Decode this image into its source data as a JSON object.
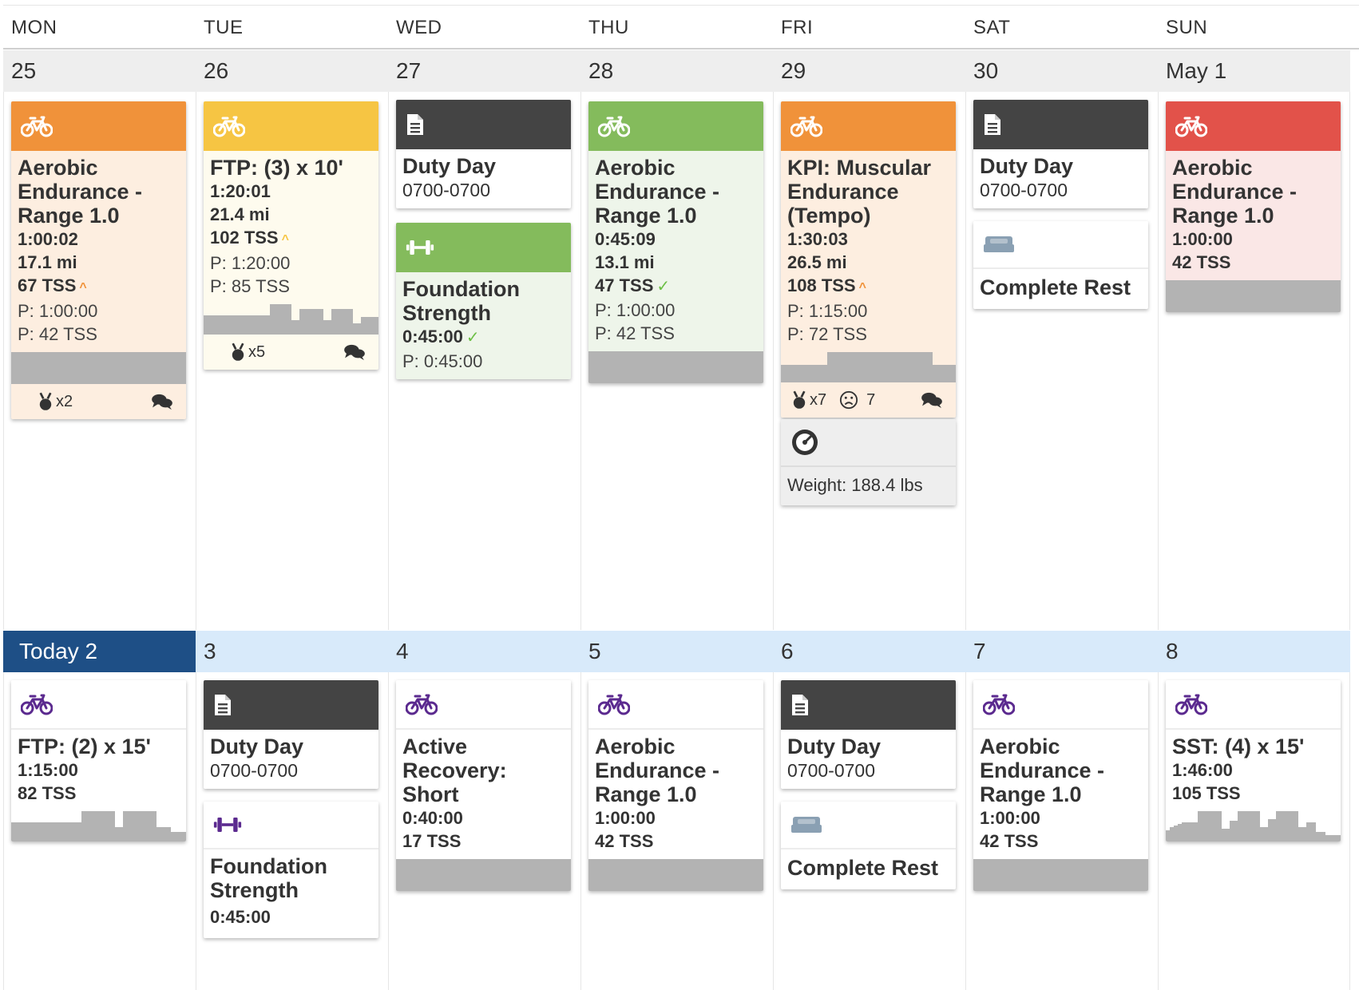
{
  "header": {
    "days": [
      "MON",
      "TUE",
      "WED",
      "THU",
      "FRI",
      "SAT",
      "SUN"
    ]
  },
  "colors": {
    "orange": "#f0923a",
    "yellow": "#f6c543",
    "green": "#84bb5c",
    "red": "#e2524a",
    "dark": "#444444",
    "purple": "#5b2a8f",
    "today": "#1e4f86"
  },
  "weeks": [
    {
      "dates": [
        "25",
        "26",
        "27",
        "28",
        "29",
        "30",
        "May 1"
      ],
      "mon": {
        "title": "Aerobic Endurance - Range 1.0",
        "duration": "1:00:02",
        "distance": "17.1 mi",
        "tss": "67 TSS",
        "planned_duration": "P: 1:00:00",
        "planned_tss": "P: 42 TSS",
        "medals": "x2",
        "icon": "bike-icon",
        "status": "orange"
      },
      "tue": {
        "title": "FTP: (3) x 10'",
        "duration": "1:20:01",
        "distance": "21.4 mi",
        "tss": "102 TSS",
        "planned_duration": "P: 1:20:00",
        "planned_tss": "P: 85 TSS",
        "medals": "x5",
        "icon": "bike-icon",
        "status": "yellow"
      },
      "wed": {
        "duty_title": "Duty Day",
        "duty_hours": "0700-0700",
        "strength_title": "Foundation Strength",
        "strength_duration": "0:45:00",
        "strength_planned": "P: 0:45:00"
      },
      "thu": {
        "title": "Aerobic Endurance - Range 1.0",
        "duration": "0:45:09",
        "distance": "13.1 mi",
        "tss": "47 TSS",
        "planned_duration": "P: 1:00:00",
        "planned_tss": "P: 42 TSS",
        "icon": "bike-icon",
        "status": "green"
      },
      "fri": {
        "title": "KPI: Muscular Endurance (Tempo)",
        "duration": "1:30:03",
        "distance": "26.5 mi",
        "tss": "108 TSS",
        "planned_duration": "P: 1:15:00",
        "planned_tss": "P: 72 TSS",
        "medals": "x7",
        "feeling": "7",
        "metric_label": "Weight: 188.4 lbs",
        "icon": "bike-icon",
        "status": "orange"
      },
      "sat": {
        "duty_title": "Duty Day",
        "duty_hours": "0700-0700",
        "rest_title": "Complete Rest"
      },
      "sun": {
        "title": "Aerobic Endurance - Range 1.0",
        "duration": "1:00:00",
        "tss": "42 TSS",
        "icon": "bike-icon",
        "status": "red"
      }
    },
    {
      "today_label": "Today 2",
      "dates": [
        "3",
        "4",
        "5",
        "6",
        "7",
        "8"
      ],
      "mon": {
        "title": "FTP: (2) x 15'",
        "duration": "1:15:00",
        "tss": "82 TSS"
      },
      "tue": {
        "duty_title": "Duty Day",
        "duty_hours": "0700-0700",
        "strength_title": "Foundation Strength",
        "strength_duration": "0:45:00"
      },
      "wed": {
        "title": "Active Recovery: Short",
        "duration": "0:40:00",
        "tss": "17 TSS"
      },
      "thu": {
        "title": "Aerobic Endurance - Range 1.0",
        "duration": "1:00:00",
        "tss": "42 TSS"
      },
      "fri": {
        "duty_title": "Duty Day",
        "duty_hours": "0700-0700",
        "rest_title": "Complete Rest"
      },
      "sat": {
        "title": "Aerobic Endurance - Range 1.0",
        "duration": "1:00:00",
        "tss": "42 TSS"
      },
      "sun": {
        "title": "SST: (4) x 15'",
        "duration": "1:46:00",
        "tss": "105 TSS"
      }
    }
  ]
}
